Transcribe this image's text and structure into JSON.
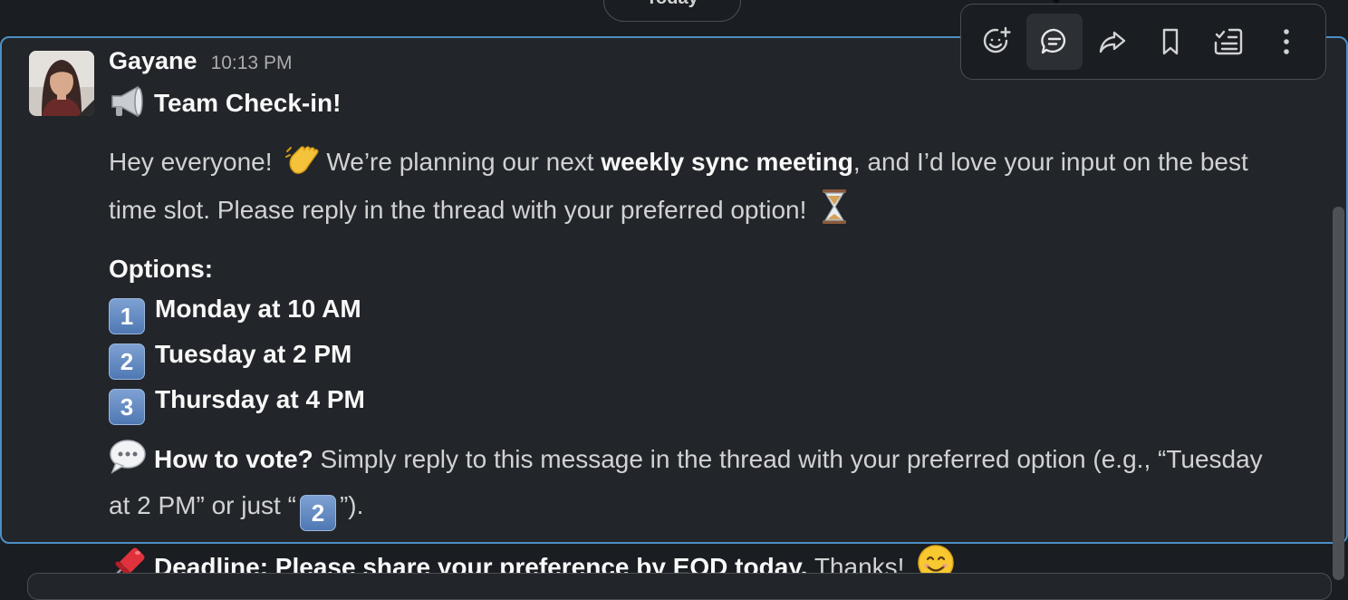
{
  "date_divider": "Today",
  "message": {
    "author": "Gayane",
    "time": "10:13 PM",
    "title": "Team Check-in!",
    "intro_pre": "Hey everyone!",
    "intro_mid": "We’re planning our next",
    "intro_bold": "weekly sync meeting",
    "intro_post": ", and I’d love your input on the best",
    "intro_line2": "time slot. Please reply in the thread with your preferred option!",
    "options_label": "Options:",
    "options": [
      {
        "key": "1",
        "label": "Monday at 10 AM"
      },
      {
        "key": "2",
        "label": "Tuesday at 2 PM"
      },
      {
        "key": "3",
        "label": "Thursday at 4 PM"
      }
    ],
    "vote_bold": "How to vote?",
    "vote_text": "Simply reply to this message in the thread with your preferred option (e.g., “Tuesday",
    "vote_line2_pre": "at 2 PM” or just “",
    "vote_line2_key": "2",
    "vote_line2_post": "”).",
    "deadline_bold": "Deadline: Please share your preference by EOD today.",
    "deadline_text": "Thanks!"
  },
  "toolbar": {
    "buttons": [
      "add-reaction-icon",
      "reply-in-thread-icon",
      "forward-icon",
      "bookmark-icon",
      "add-to-list-icon",
      "more-actions-icon"
    ]
  },
  "colors": {
    "background": "#1a1d21",
    "message_highlight_border": "#4d8fc4",
    "message_bg": "#222529"
  }
}
